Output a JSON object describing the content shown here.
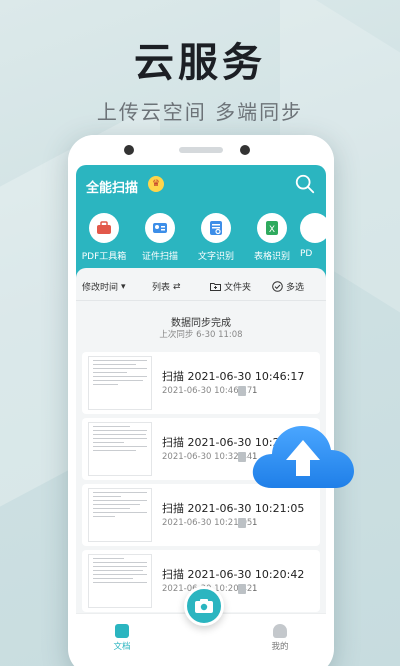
{
  "headline": "云服务",
  "subline": "上传云空间 多端同步",
  "app": {
    "title": "全能扫描",
    "tools": [
      {
        "label": "PDF工具箱",
        "icon": "toolbox-icon"
      },
      {
        "label": "证件扫描",
        "icon": "id-card-icon"
      },
      {
        "label": "文字识别",
        "icon": "text-recognition-icon"
      },
      {
        "label": "表格识别",
        "icon": "excel-icon"
      },
      {
        "label": "PD",
        "icon": "pdf-icon"
      }
    ],
    "toolbar": {
      "sort": "修改时间",
      "view": "列表",
      "folder": "文件夹",
      "multi": "多选"
    },
    "sync": {
      "title": "数据同步完成",
      "time": "上次同步 6-30 11:08"
    },
    "documents": [
      {
        "title": "扫描 2021-06-30 10:46:17",
        "date": "2021-06-30 10:46:17",
        "pages": "1"
      },
      {
        "title": "扫描 2021-06-30 10:20",
        "date": "2021-06-30 10:32:44",
        "pages": "1"
      },
      {
        "title": "扫描 2021-06-30 10:21:05",
        "date": "2021-06-30 10:21:05",
        "pages": "1"
      },
      {
        "title": "扫描 2021-06-30 10:20:42",
        "date": "2021-06-30 10:20:42",
        "pages": "1"
      }
    ],
    "nav": {
      "docs": "文档",
      "mine": "我的"
    }
  },
  "colors": {
    "accent": "#2bb5c0",
    "cloud": "#2d8ff0"
  }
}
